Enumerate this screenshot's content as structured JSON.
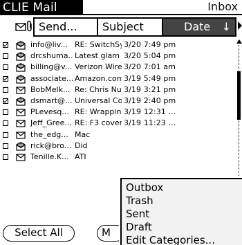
{
  "titlebar": {
    "app_title": "CLIE Mail",
    "category": "Inbox"
  },
  "header": {
    "sender_label": "Send...",
    "subject_label": "Subject",
    "date_label": "Date",
    "sort_indicator": "↓",
    "icons": [
      "envelope-icon",
      "paperclip-icon"
    ]
  },
  "messages": [
    {
      "checked": true,
      "status": "read",
      "sender": "info@liv...",
      "subject": "RE: SwitchSyn...",
      "date": "3/20 7:49 pm"
    },
    {
      "checked": false,
      "status": "read",
      "sender": "drcshuma...",
      "subject": "Latest glam s...",
      "date": "3/20 5:04 pm"
    },
    {
      "checked": false,
      "status": "read",
      "sender": "billing@v...",
      "subject": "Verizon Wire...",
      "date": "3/20 7:01 am"
    },
    {
      "checked": true,
      "status": "read",
      "sender": "associate...",
      "subject": "Amazon.com ...",
      "date": "3/19 5:49 pm"
    },
    {
      "checked": false,
      "status": "unread",
      "sender": "BobMelk...",
      "subject": "Re: Chris Null",
      "date": "3/19 3:21 pm"
    },
    {
      "checked": true,
      "status": "read",
      "sender": "dsmart@...",
      "subject": "Universal Co...",
      "date": "3/19 2:40 pm"
    },
    {
      "checked": false,
      "status": "unread",
      "sender": "PLevesq...",
      "subject": "RE: Wrapping...",
      "date": "3/19 12:31 ..."
    },
    {
      "checked": false,
      "status": "unread",
      "sender": "Jeff_Gree...",
      "subject": "RE: F3 covera...",
      "date": "3/19 11:23 ..."
    },
    {
      "checked": false,
      "status": "unread",
      "sender": "the_edg...",
      "subject": "Mac",
      "date": ""
    },
    {
      "checked": false,
      "status": "read",
      "sender": "rick@bro...",
      "subject": "Did",
      "date": ""
    },
    {
      "checked": false,
      "status": "unread",
      "sender": "Tenille.K...",
      "subject": "ATI",
      "date": ""
    }
  ],
  "buttons": {
    "select_all": "Select All",
    "partial": "M"
  },
  "menu": {
    "items": [
      "Outbox",
      "Trash",
      "Sent",
      "Draft",
      "Edit Categories..."
    ]
  }
}
